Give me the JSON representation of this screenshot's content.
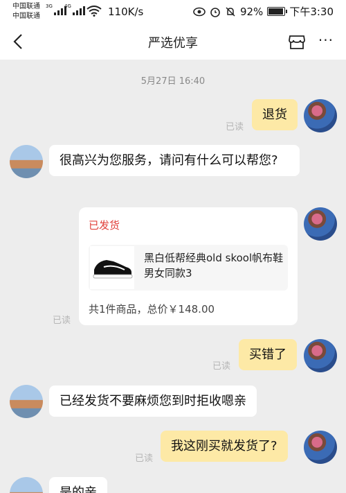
{
  "status_bar": {
    "carrier_1": "中国联通",
    "carrier_2": "中国联通",
    "net_1": "3G",
    "net_2": "4G",
    "speed": "110K/s",
    "battery": "92%",
    "battery_level": 0.92,
    "time": "下午3:30"
  },
  "header": {
    "title": "严选优享"
  },
  "chat": {
    "timestamp": "5月27日 16:40",
    "read_label": "已读",
    "messages": [
      {
        "text": "退货"
      },
      {
        "text": "很高兴为您服务，请问有什么可以帮您?"
      },
      {
        "text": "买错了"
      },
      {
        "text": "已经发货不要麻烦您到时拒收嗯亲"
      },
      {
        "text": "我这刚买就发货了?"
      },
      {
        "text": "是的亲"
      }
    ],
    "order_card": {
      "status": "已发货",
      "product_name": "黑白低帮经典old skool帆布鞋男女同款3",
      "summary": "共1件商品，总价￥148.00"
    }
  },
  "colors": {
    "my_bubble": "#fde9a6",
    "their_bubble": "#ffffff",
    "status_red": "#e0403a",
    "background": "#ededed"
  }
}
